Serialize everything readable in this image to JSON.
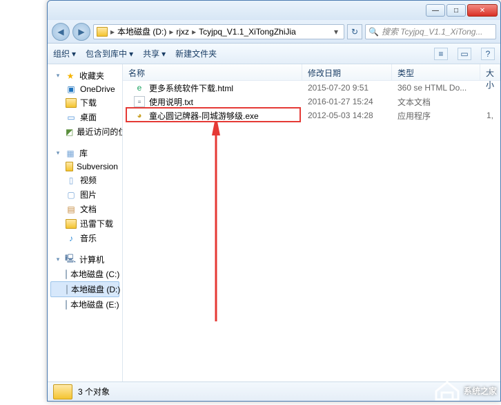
{
  "titlebar": {
    "min": "—",
    "max": "□",
    "close": "✕"
  },
  "nav": {
    "back": "◀",
    "fwd": "▶",
    "crumbs": [
      "本地磁盘 (D:)",
      "rjxz",
      "Tcyjpq_V1.1_XiTongZhiJia"
    ],
    "sep": "▸",
    "drop": "▾",
    "refresh": "↻",
    "search_placeholder": "搜索 Tcyjpq_V1.1_XiTong...",
    "mag": "🔍"
  },
  "toolbar": {
    "organize": "组织",
    "include": "包含到库中",
    "share": "共享",
    "new_folder": "新建文件夹",
    "drop": "▾",
    "icons": {
      "view": "≡",
      "pane": "▭",
      "help": "?"
    }
  },
  "tree": {
    "fav": {
      "label": "收藏夹",
      "items": [
        "OneDrive",
        "下载",
        "桌面",
        "最近访问的位置"
      ]
    },
    "lib": {
      "label": "库",
      "items": [
        "Subversion",
        "视频",
        "图片",
        "文档",
        "迅雷下载",
        "音乐"
      ]
    },
    "comp": {
      "label": "计算机",
      "items": [
        "本地磁盘 (C:)",
        "本地磁盘 (D:)",
        "本地磁盘 (E:)"
      ]
    }
  },
  "columns": {
    "name": "名称",
    "date": "修改日期",
    "type": "类型",
    "size": "大小"
  },
  "files": [
    {
      "name": "更多系统软件下载.html",
      "date": "2015-07-20 9:51",
      "type": "360 se HTML Do...",
      "size": "",
      "ico": "html"
    },
    {
      "name": "使用说明.txt",
      "date": "2016-01-27 15:24",
      "type": "文本文档",
      "size": "",
      "ico": "txt"
    },
    {
      "name": "童心圆记牌器-同城游够级.exe",
      "date": "2012-05-03 14:28",
      "type": "应用程序",
      "size": "1,",
      "ico": "exe"
    }
  ],
  "status": {
    "count": "3 个对象"
  },
  "watermark": "系统之家",
  "tri": {
    "open": "▾",
    "closed": "▸"
  }
}
